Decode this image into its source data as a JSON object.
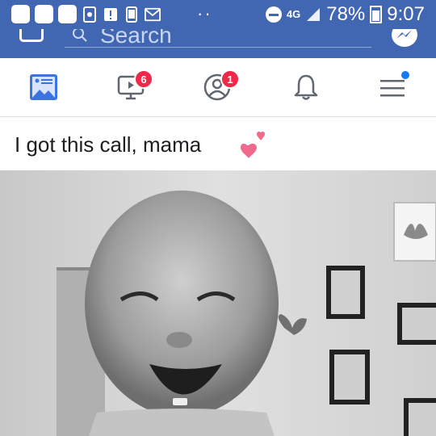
{
  "status_bar": {
    "dots": "··",
    "network": "4G",
    "battery": "78%",
    "time": "9:07"
  },
  "search": {
    "placeholder": "Search"
  },
  "nav": {
    "videos_badge": "6",
    "friends_badge": "1"
  },
  "post": {
    "text": "I got this call, mama"
  },
  "colors": {
    "brand": "#4267b2",
    "badge": "#f0284a",
    "heart": "#f06a8b"
  }
}
